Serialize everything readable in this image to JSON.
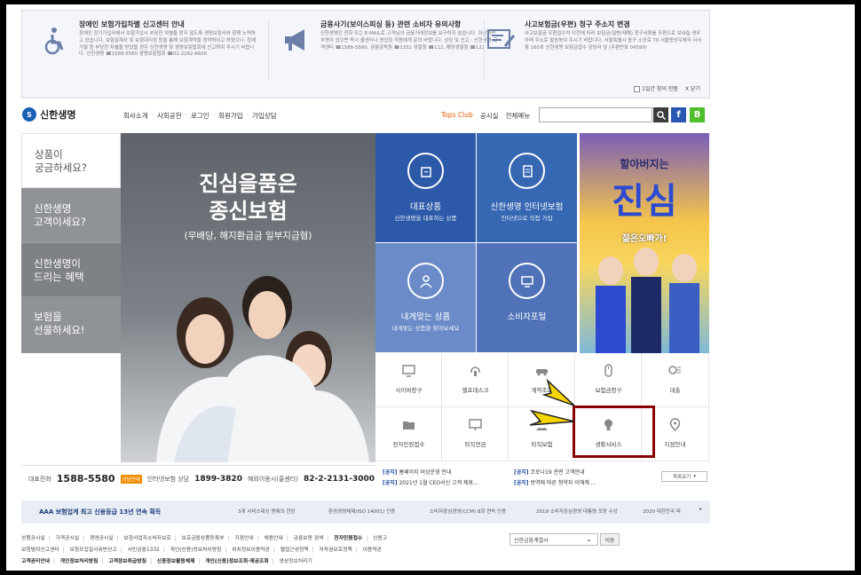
{
  "notice": {
    "col1": {
      "title": "장애인 보험가입차별 신고센터 안내",
      "body": "장애인 장기가입자에서 보험가입시 부당한 차별을 받지 않도록 생명보험사와 함께 노력하고 있습니다. 보험설계사 및 보험대리점 등을 통해 보험계약을 청약하려고 하였으나, 장애 거절 등 부당한 차별을 받았을 경우 신한생명 및 생명보험협회에 신고하여 주시기 바랍니다. 신한생명 ☎1588-5580 생명보험협회 ☎02-2262-6600"
    },
    "col2": {
      "title": "금융사기(보이스피싱 등) 관련 소비자 유의사항",
      "body": "신한생명은 전화 또는 E-MAIL로 고객님의 금융거래정보를 요구하지 않습니다. 이상하면 부명이 있으면 즉시 콜센터나 영업점 직원에게 문의 바랍니다. 상담 및 신고 : 신한생명 고객센터 ☎1588-5580, 금융감독원 ☎1332  경찰청 ☎112, 해양경찰청 ☎122"
    },
    "col3": {
      "title": "사고보험금(우편) 청구 주소지 변경",
      "body": "사고보험금 우편접수처 이전에 따라 보험금(질병/재해) 청구서류를 우편으로 보내실 경우 아래 주소로 발송하여 주시기 바랍니다. 서울특별시 중구 소공로 70 서울중앙우체국 사서함 160호 신한생명 보험금접수 담당자 앞 (우편번호 04599)"
    },
    "dont_show": "1일간 창이 안뜸",
    "close": "X 닫기"
  },
  "header": {
    "logo": "신한생명",
    "gnb": [
      "회사소개",
      "사회공헌",
      "로그인",
      "회원가입",
      "가입상담"
    ],
    "tops_club": "Tops Club",
    "public": "공시실",
    "all_menu": "전체메뉴",
    "search_placeholder": ""
  },
  "left_menu": [
    {
      "line1": "상품이",
      "line2": "궁금하세요?"
    },
    {
      "line1": "신한생명",
      "line2": "고객이세요?"
    },
    {
      "line1": "신한생명이",
      "line2": "드리는 혜택"
    },
    {
      "line1": "보험을",
      "line2": "선물하세요!"
    }
  ],
  "hero": {
    "line1": "진심을품은",
    "line2": "종신보험",
    "sub": "(무배당, 해지환급금 일부지급형)"
  },
  "products": [
    {
      "title": "대표상품",
      "desc": "신한생명을 대표하는 상품"
    },
    {
      "title": "신한생명 인터넷보험",
      "desc": "인터넷으로 직접 가입"
    },
    {
      "title": "내게맞는 상품",
      "desc": "내게맞는 상품을 찾아보세요"
    },
    {
      "title": "소비자포털",
      "desc": ""
    }
  ],
  "promo": {
    "line1": "할아버지는",
    "line2": "진심",
    "line3": "젊은오빠가!"
  },
  "quick": [
    {
      "label": "사이버창구",
      "icon": "monitor-icon"
    },
    {
      "label": "헬프데스크",
      "icon": "headset-icon"
    },
    {
      "label": "계약조회",
      "icon": "car-icon"
    },
    {
      "label": "보험금청구",
      "icon": "mouse-icon"
    },
    {
      "label": "대출",
      "icon": "coin-icon"
    },
    {
      "label": "전자민원접수",
      "icon": "folder-icon"
    },
    {
      "label": "퇴직연금",
      "icon": "chart-icon"
    },
    {
      "label": "퇴직보험",
      "icon": "people-icon"
    },
    {
      "label": "생활서비스",
      "icon": "bulb-icon"
    },
    {
      "label": "지점안내",
      "icon": "pin-icon"
    }
  ],
  "contact": {
    "rep_label": "대표전화",
    "rep": "1588-5580",
    "rep_tag": "상담안내",
    "online_label": "인터넷보험 상담",
    "online": "1899-3820",
    "overseas_label": "해외이용시(콜센터)",
    "overseas": "82-2-2131-3000"
  },
  "notices": [
    {
      "tag": "[공지]",
      "text": "홈페이지 비상운영 안내"
    },
    {
      "tag": "[공지]",
      "text": "2021년 1월 CEO서신 고객 제휴..."
    },
    {
      "tag": "[공지]",
      "text": "코로나19 관련 고객안내"
    },
    {
      "tag": "[공지]",
      "text": "방역에 따른 청약자 이해계 ..."
    }
  ],
  "more_notices": "목록보기",
  "awards": {
    "aaa": "AAA 보험업계 최고 신용등급 13년 연속 획득",
    "items": [
      "3개 서비스대상 명예의 전당",
      "환경경영체제(ISO 14001) 인증",
      "소비자중심경영(CCM) 8회 연속 인증",
      "2019 소비자중심경영 대통령 포장 수상",
      "2020 대한민국 퍼"
    ]
  },
  "footer": {
    "row1": [
      "상품공시실",
      "가격공시실",
      "경영공시실",
      "보험사업자소비자보호",
      "보호금융상품등록부",
      "지점안내",
      "채용안내",
      "금융보증 검색",
      "전자민원접수",
      "신용고"
    ],
    "row2": [
      "보험범죄신고센터",
      "보험모집질서위반신고",
      "서민금융1332",
      "개인(신용)정보처리방침",
      "위치정보이용약관",
      "웹접근성정책",
      "저작권보호정책",
      "이용약관"
    ],
    "row3": [
      "고객권리안내",
      "개인정보처리방침",
      "고객정보취급방침",
      "신용정보활용체제",
      "개인(신용)정보조회·제공조회",
      "영상정보처리기"
    ],
    "family_site": "신한금융계열사",
    "go": "이동"
  }
}
